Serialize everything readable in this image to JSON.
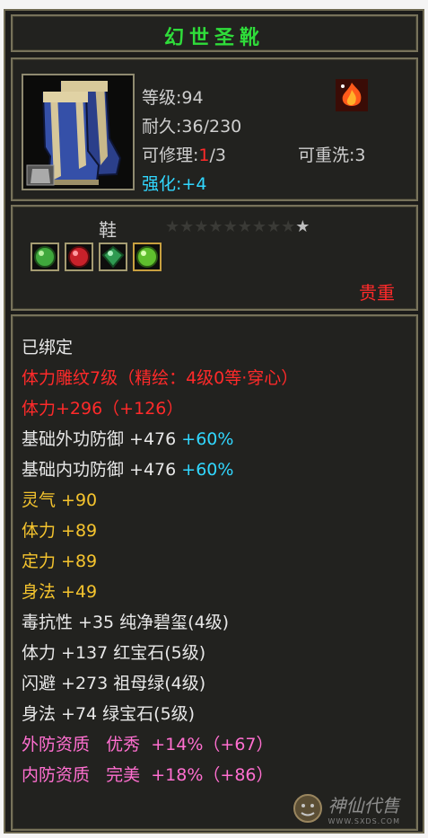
{
  "item": {
    "name": "幻世圣靴",
    "level_label": "等级:",
    "level": "94",
    "durability_label": "耐久:",
    "durability": "36/230",
    "repair_label": "可修理:",
    "repair_used": "1",
    "repair_total": "/3",
    "rewash_label": "可重洗:",
    "rewash": "3",
    "enhance_label": "强化:",
    "enhance": "+4",
    "type": "鞋",
    "rarity": "贵重",
    "stars_total": 10,
    "stars_filled": 0
  },
  "gems": [
    {
      "icon": "green-gem-icon",
      "color": "#3fa83c"
    },
    {
      "icon": "red-gem-icon",
      "color": "#c8212a"
    },
    {
      "icon": "emerald-gem-icon",
      "color": "#2f9a52"
    },
    {
      "icon": "green-gem-icon",
      "color": "#5fbf2e"
    }
  ],
  "attributes": {
    "bound": "已绑定",
    "engrave": "体力雕纹7级（精绘：4级0等·穿心）",
    "stamina_main": "体力+296（+126）",
    "ext_def_label": "基础外功防御 +476",
    "ext_def_bonus": "+60%",
    "int_def_label": "基础内功防御 +476",
    "int_def_bonus": "+60%",
    "stat1": "灵气 +90",
    "stat2": "体力 +89",
    "stat3": "定力 +89",
    "stat4": "身法 +49",
    "gem1": "毒抗性 +35 纯净碧玺(4级)",
    "gem2": "体力 +137 红宝石(5级)",
    "gem3": "闪避 +273 祖母绿(4级)",
    "gem4": "身法 +74 绿宝石(5级)",
    "q1_label": "外防资质",
    "q1_grade": "优秀",
    "q1_value": "+14%（+67）",
    "q2_label": "内防资质",
    "q2_grade": "完美",
    "q2_value": "+18%（+86）"
  },
  "watermark": {
    "text": "神仙代售",
    "url": "WWW.SXDS.COM"
  },
  "colors": {
    "title": "#2fdc3a",
    "red": "#ff2a2a",
    "cyan": "#31d7ff",
    "yellow": "#f5c42e",
    "pink": "#ff6fd0"
  }
}
